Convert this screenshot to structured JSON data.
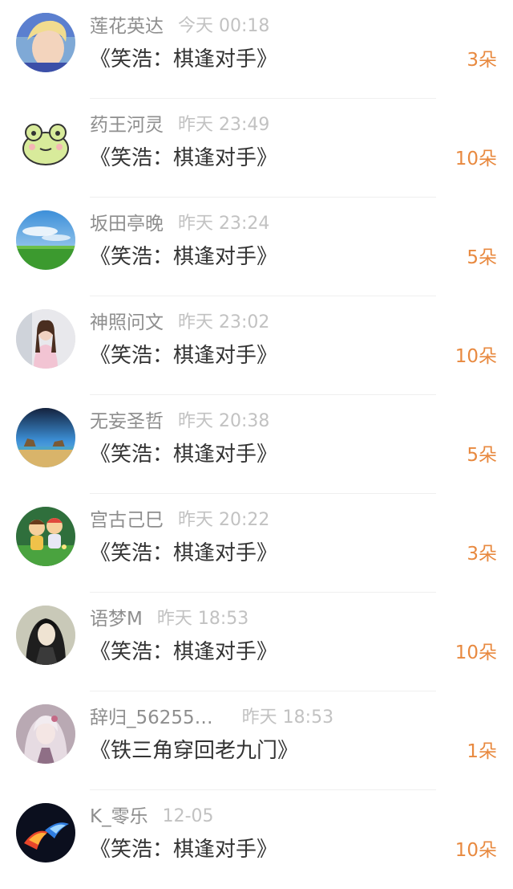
{
  "colors": {
    "name": "#8e8e8e",
    "time": "#c2c2c2",
    "title": "#333333",
    "count": "#e8893f",
    "divider": "#efefef"
  },
  "items": [
    {
      "name": "莲花英达",
      "time": "今天 00:18",
      "title": "《笑浩：棋逢对手》",
      "count": "3朵",
      "avatar": "photo-blond-person"
    },
    {
      "name": "药王河灵",
      "time": "昨天 23:49",
      "title": "《笑浩：棋逢对手》",
      "count": "10朵",
      "avatar": "frog-cartoon"
    },
    {
      "name": "坂田亭晚",
      "time": "昨天 23:24",
      "title": "《笑浩：棋逢对手》",
      "count": "5朵",
      "avatar": "sky-grass-landscape"
    },
    {
      "name": "神照问文",
      "time": "昨天 23:02",
      "title": "《笑浩：棋逢对手》",
      "count": "10朵",
      "avatar": "photo-woman"
    },
    {
      "name": "无妄圣哲",
      "time": "昨天 20:38",
      "title": "《笑浩：棋逢对手》",
      "count": "5朵",
      "avatar": "beach-rocks-landscape"
    },
    {
      "name": "宫古己巳",
      "time": "昨天 20:22",
      "title": "《笑浩：棋逢对手》",
      "count": "3朵",
      "avatar": "cartoon-kids"
    },
    {
      "name": "语梦M",
      "time": "昨天 18:53",
      "title": "《笑浩：棋逢对手》",
      "count": "10朵",
      "avatar": "anime-character"
    },
    {
      "name": "辞归_56255…",
      "time": "昨天 18:53",
      "title": "《铁三角穿回老九门》",
      "count": "1朵",
      "avatar": "illustrated-girl"
    },
    {
      "name": "K_零乐",
      "time": "12-05",
      "title": "《笑浩：棋逢对手》",
      "count": "10朵",
      "avatar": "fire-ice-abstract"
    }
  ]
}
